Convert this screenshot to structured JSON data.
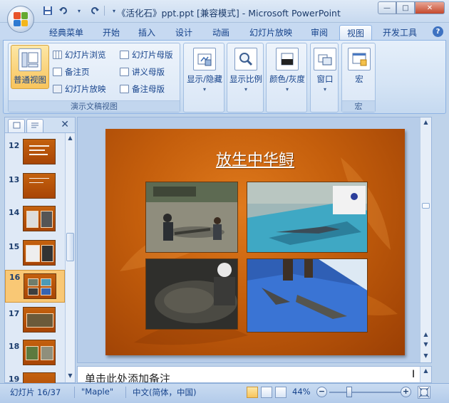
{
  "window": {
    "title": "《活化石》ppt.ppt [兼容模式] - Microsoft PowerPoint",
    "minimize_glyph": "—",
    "maximize_glyph": "□",
    "close_glyph": "✕"
  },
  "quick_access": {
    "save_icon": "save-icon",
    "undo_icon": "undo-icon",
    "redo_icon": "redo-icon",
    "customize_icon": "dropdown-arrow-icon"
  },
  "ribbon_tabs": [
    {
      "label": "经典菜单",
      "active": false
    },
    {
      "label": "开始",
      "active": false
    },
    {
      "label": "插入",
      "active": false
    },
    {
      "label": "设计",
      "active": false
    },
    {
      "label": "动画",
      "active": false
    },
    {
      "label": "幻灯片放映",
      "active": false
    },
    {
      "label": "审阅",
      "active": false
    },
    {
      "label": "视图",
      "active": true
    },
    {
      "label": "开发工具",
      "active": false
    }
  ],
  "ribbon": {
    "presentation_views": {
      "group_label": "演示文稿视图",
      "normal_view": "普通视图",
      "slide_sorter": "幻灯片浏览",
      "notes_page": "备注页",
      "slide_show": "幻灯片放映",
      "slide_master": "幻灯片母版",
      "handout_master": "讲义母版",
      "notes_master": "备注母版"
    },
    "show_hide": "显示/隐藏",
    "zoom": "显示比例",
    "color_grayscale": "颜色/灰度",
    "window": "窗口",
    "macros": {
      "label": "宏",
      "group_label": "宏"
    }
  },
  "slide_panel": {
    "close_glyph": "✕",
    "thumbnails": [
      {
        "number": "12",
        "selected": false
      },
      {
        "number": "13",
        "selected": false
      },
      {
        "number": "14",
        "selected": false
      },
      {
        "number": "15",
        "selected": false
      },
      {
        "number": "16",
        "selected": true
      },
      {
        "number": "17",
        "selected": false
      },
      {
        "number": "18",
        "selected": false
      },
      {
        "number": "19",
        "selected": false
      }
    ]
  },
  "slide": {
    "title": "放生中华鲟"
  },
  "notes": {
    "placeholder": "单击此处添加备注"
  },
  "status_bar": {
    "slide_counter": "幻灯片 16/37",
    "theme": "\"Maple\"",
    "language": "中文(简体，中国)",
    "zoom_level": "44%",
    "zoom_out": "−",
    "zoom_in": "+",
    "zoom_fraction": 0.28
  },
  "colors": {
    "slide_background": "#c45e0c",
    "ribbon_bg": "#d5e4f5",
    "selection": "#f8c45c"
  }
}
